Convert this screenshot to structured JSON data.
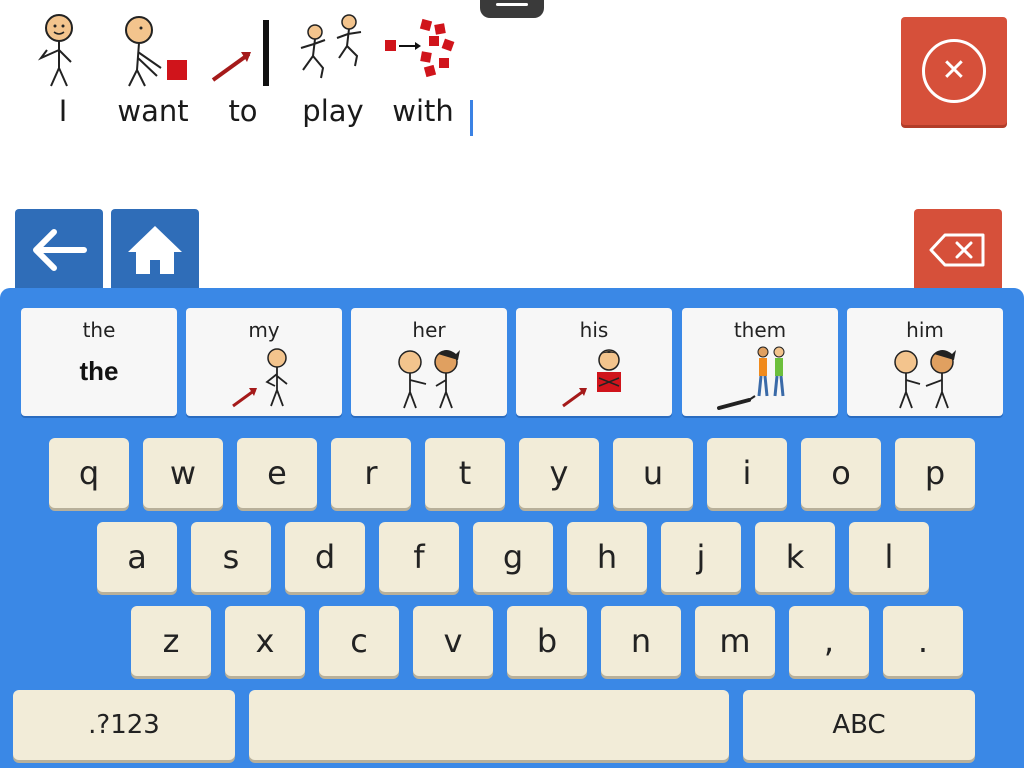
{
  "sentence": {
    "words": [
      {
        "text": "I",
        "symbol": "person-pointing-self"
      },
      {
        "text": "want",
        "symbol": "person-reaching-for-block"
      },
      {
        "text": "to",
        "symbol": "arrow-to-line"
      },
      {
        "text": "play",
        "symbol": "people-running"
      },
      {
        "text": "with",
        "symbol": "blocks-arrow-group"
      }
    ]
  },
  "toolbar": {
    "clear_icon": "close-circle-icon",
    "back_icon": "arrow-left-icon",
    "home_icon": "home-icon",
    "backspace_icon": "backspace-icon"
  },
  "predictions": [
    {
      "label": "the",
      "display": "the",
      "symbol": "text-only"
    },
    {
      "label": "my",
      "symbol": "arrow-to-person-self"
    },
    {
      "label": "her",
      "symbol": "boy-pointing-at-girl"
    },
    {
      "label": "his",
      "symbol": "arrow-to-boy-chest"
    },
    {
      "label": "them",
      "symbol": "pointing-at-two-people"
    },
    {
      "label": "him",
      "symbol": "girl-pointing-at-boy"
    }
  ],
  "keys": {
    "row1": [
      "q",
      "w",
      "e",
      "r",
      "t",
      "y",
      "u",
      "i",
      "o",
      "p"
    ],
    "row2": [
      "a",
      "s",
      "d",
      "f",
      "g",
      "h",
      "j",
      "k",
      "l"
    ],
    "row3": [
      "z",
      "x",
      "c",
      "v",
      "b",
      "n",
      "m",
      ",",
      "."
    ],
    "numbers_label": ".?123",
    "space_label": "",
    "abc_label": "ABC"
  },
  "colors": {
    "keyboard_bg": "#3a88e6",
    "nav_blue": "#2f6db8",
    "danger_red": "#d6503a",
    "key_cream": "#f2ecd8",
    "cursor_blue": "#3b82e4"
  }
}
